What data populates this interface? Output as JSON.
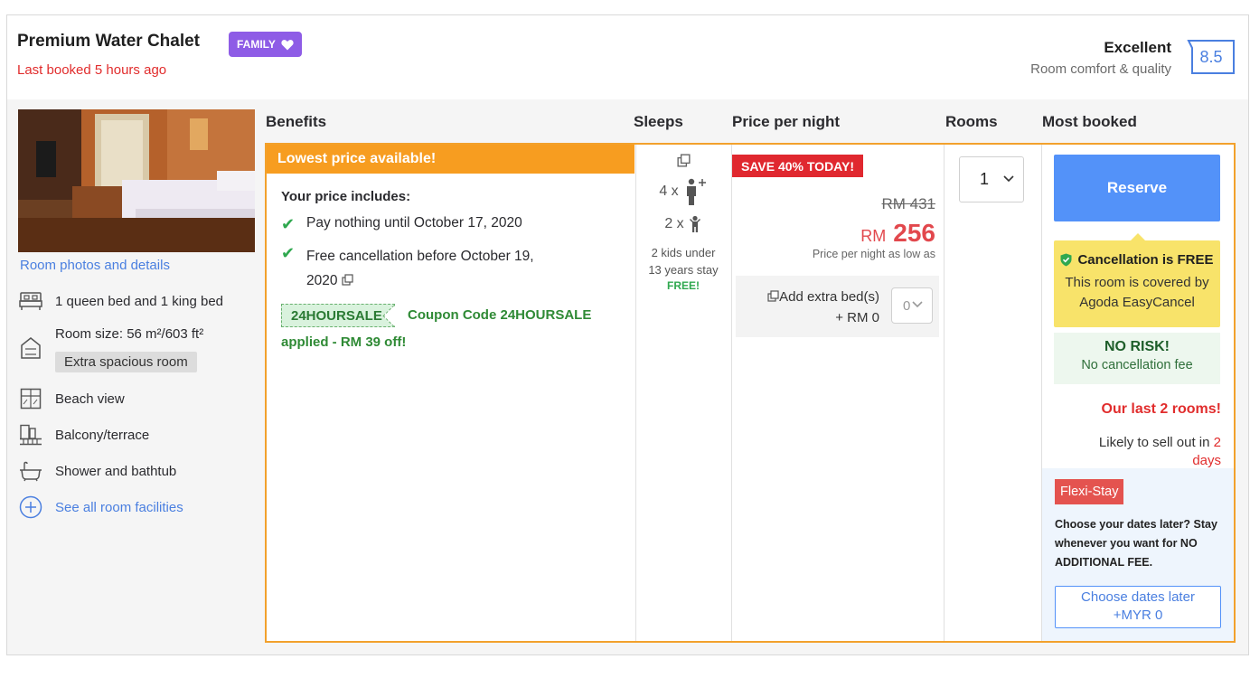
{
  "room": {
    "title": "Premium Water Chalet",
    "badge": "FAMILY",
    "last_booked": "Last booked 5 hours ago"
  },
  "rating": {
    "word": "Excellent",
    "subtitle": "Room comfort & quality",
    "score": "8.5"
  },
  "left": {
    "photo_link": "Room photos and details",
    "facilities": [
      {
        "label": "1 queen bed and 1 king bed",
        "icon": "bed-icon"
      },
      {
        "label": "Room size: 56 m²/603 ft²",
        "icon": "room-size-icon"
      },
      {
        "label": "Beach view",
        "icon": "window-view-icon"
      },
      {
        "label": "Balcony/terrace",
        "icon": "balcony-icon"
      },
      {
        "label": "Shower and bathtub",
        "icon": "bathtub-icon"
      }
    ],
    "extra_tag": "Extra spacious room",
    "see_all": "See all room facilities"
  },
  "columns": {
    "benefits": "Benefits",
    "sleeps": "Sleeps",
    "price": "Price per night",
    "rooms": "Rooms",
    "most_booked": "Most booked"
  },
  "offer": {
    "banner": "Lowest price available!",
    "includes_title": "Your price includes:",
    "benefit_1": "Pay nothing until October 17, 2020",
    "benefit_2_line1": "Free cancellation before October 19,",
    "benefit_2_line2": "2020",
    "coupon_code": "24HOURSALE",
    "coupon_desc": "Coupon Code 24HOURSALE",
    "coupon_desc2": "applied - RM 39 off!"
  },
  "sleeps": {
    "adults": "4 x",
    "children": "2 x",
    "kids_note_1": "2 kids under",
    "kids_note_2": "13 years stay",
    "free": "FREE!"
  },
  "price": {
    "save_badge": "SAVE 40% TODAY!",
    "old": "RM 431",
    "currency": "RM",
    "amount": "256",
    "note": "Price per night as low as",
    "extra_bed_label": "Add extra bed(s)",
    "extra_bed_price": "+ RM 0",
    "extra_bed_value": "0"
  },
  "rooms": {
    "selected": "1"
  },
  "most_booked": {
    "reserve": "Reserve",
    "cancel_title": "Cancellation is FREE",
    "cancel_desc_1": "This room is covered by",
    "cancel_desc_2": "Agoda EasyCancel",
    "norisk_title": "NO RISK!",
    "norisk_sub": "No cancellation fee",
    "last_rooms": "Our last 2 rooms!",
    "sellout_text": "Likely to sell out in",
    "sellout_num": "2",
    "sellout_unit": "days",
    "flexi_badge": "Flexi-Stay",
    "flexi_desc": "Choose your dates later? Stay whenever you want for NO ADDITIONAL FEE.",
    "flexi_btn_1": "Choose dates later",
    "flexi_btn_2": "+MYR 0"
  },
  "colors": {
    "accent_blue": "#5392f9",
    "orange": "#f79d20",
    "red": "#e12d2d",
    "purple": "#8e5ce6"
  }
}
